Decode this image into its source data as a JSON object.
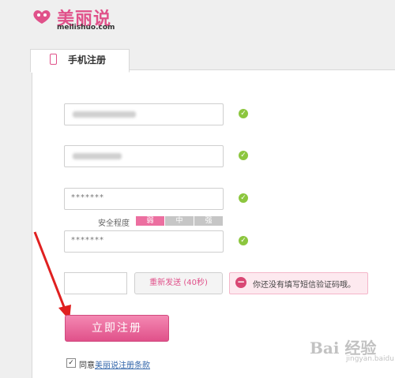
{
  "brand": {
    "name_cn": "美丽说",
    "name_en": "meilishuo.com",
    "color": "#e0518a"
  },
  "tab": {
    "label": "手机注册",
    "icon": "phone-icon"
  },
  "form": {
    "field_password": "*******",
    "field_confirm": "*******",
    "strength": {
      "label": "安全程度",
      "levels": [
        "弱",
        "中",
        "强"
      ],
      "active_level": 1
    },
    "resend_label": "重新发送 (40秒)",
    "error_text": "你还没有填写短信验证码哦。",
    "submit_label": "立即注册",
    "agree_prefix": "同意",
    "agree_link": "美丽说注册条款",
    "agree_checked": "✓"
  },
  "icons": {
    "valid": "✓",
    "error": "−"
  },
  "watermark": {
    "main": "Bai 经验",
    "sub": "jingyan.baidu.com"
  }
}
